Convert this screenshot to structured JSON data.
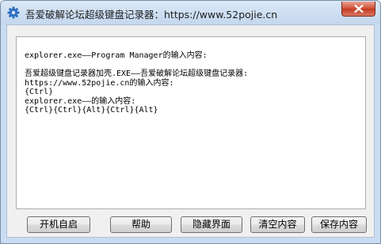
{
  "window": {
    "title": "吾爱破解论坛超级键盘记录器：https://www.52pojie.cn"
  },
  "titlebar": {
    "icon": "gear-icon",
    "close_icon": "close-icon"
  },
  "log": {
    "lines": [
      "explorer.exe——Program Manager的输入内容:",
      "",
      "吾爱超级键盘记录器加壳.EXE——吾爱破解论坛超级键盘记录器:",
      "https://www.52pojie.cn的输入内容:",
      "{Ctrl}",
      "explorer.exe——的输入内容:",
      "{Ctrl}{Ctrl}{Alt}{Ctrl}{Alt}"
    ]
  },
  "buttons": {
    "autostart": "开机自启",
    "help": "帮助",
    "hide": "隐藏界面",
    "clear": "清空内容",
    "save": "保存内容"
  },
  "colors": {
    "title_bg": "#c9dcf1",
    "close_red": "#c8432a",
    "client_bg": "#f0f0f0"
  }
}
